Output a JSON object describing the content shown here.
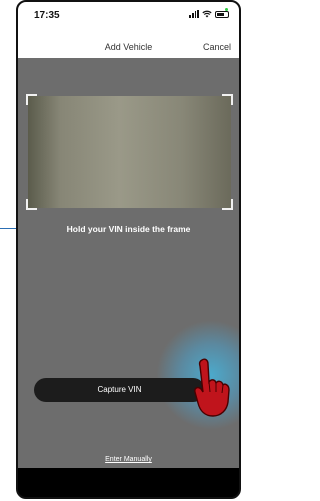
{
  "status_bar": {
    "time": "17:35"
  },
  "nav": {
    "title": "Add Vehicle",
    "cancel_label": "Cancel"
  },
  "camera": {
    "hint": "Hold your VIN inside the frame"
  },
  "actions": {
    "capture_label": "Capture VIN",
    "manual_label": "Enter Manually"
  },
  "colors": {
    "camera_bg": "#6d6d6d",
    "button_bg": "#1c1c1c",
    "glow": "#46b4dc",
    "hand": "#c0141c"
  }
}
